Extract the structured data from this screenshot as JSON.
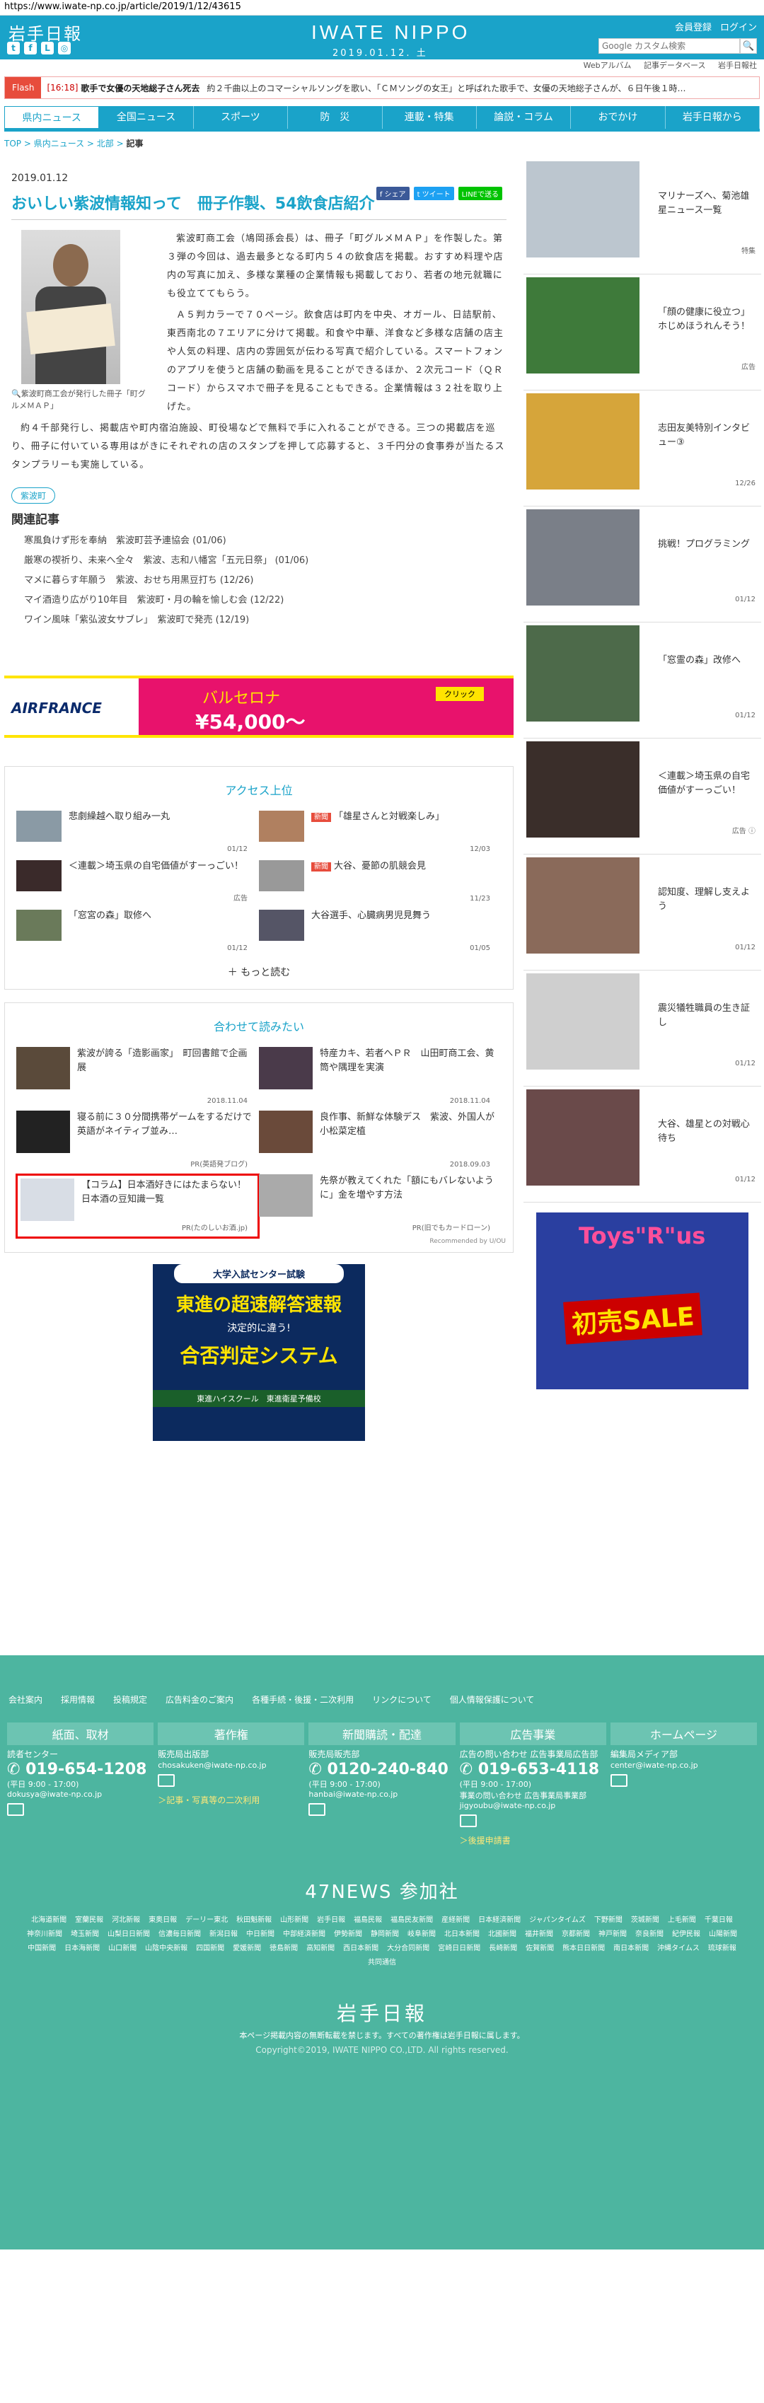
{
  "url": "https://www.iwate-np.co.jp/article/2019/1/12/43615",
  "header": {
    "logo_ja": "岩手日報",
    "logo_en": "IWATE NIPPO",
    "date": "2019.01.12. 土",
    "member": "会員登録",
    "login": "ログイン",
    "search_placeholder": "Google カスタム検索",
    "search_button": "🔍"
  },
  "subnav": [
    "Webアルバム",
    "記事データベース",
    "岩手日報社"
  ],
  "flash": {
    "tag": "Flash",
    "time": "[16:18]",
    "title": "歌手で女優の天地総子さん死去",
    "rest": "約２千曲以上のコマーシャルソングを歌い、「ＣＭソングの女王」と呼ばれた歌手で、女優の天地総子さんが、６日午後１時…"
  },
  "nav": [
    "県内ニュース",
    "全国ニュース",
    "スポーツ",
    "防　災",
    "連載・特集",
    "論説・コラム",
    "おでかけ",
    "岩手日報から"
  ],
  "breadcrumb": [
    "TOP",
    "県内ニュース",
    "北部",
    "記事"
  ],
  "article": {
    "date": "2019.01.12",
    "share": [
      "f シェア",
      "t ツイート",
      "LINEで送る"
    ],
    "title": "おいしい紫波情報知って　冊子作製、54飲食店紹介",
    "caption": "紫波町商工会が発行した冊子「町グルメＭＡＰ」",
    "p1": "紫波町商工会（鳩岡孫会長）は、冊子「町グルメＭＡＰ」を作製した。第３弾の今回は、過去最多となる町内５４の飲食店を掲載。おすすめ料理や店内の写真に加え、多様な業種の企業情報も掲載しており、若者の地元就職にも役立ててもらう。",
    "p2": "Ａ５判カラーで７０ページ。飲食店は町内を中央、オガール、日詰駅前、東西南北の７エリアに分けて掲載。和食や中華、洋食など多様な店舗の店主や人気の料理、店内の雰囲気が伝わる写真で紹介している。スマートフォンのアプリを使うと店舗の動画を見ることができるほか、２次元コード（ＱＲコード）からスマホで冊子を見ることもできる。企業情報は３２社を取り上げた。",
    "p3": "約４千部発行し、掲載店や町内宿泊施設、町役場などで無料で手に入れることができる。三つの掲載店を巡り、冊子に付いている専用はがきにそれぞれの店のスタンプを押して応募すると、３千円分の食事券が当たるスタンプラリーも実施している。",
    "tag": "紫波町",
    "related_heading": "関連記事",
    "related": [
      "寒風負けず形を奉納　紫波町芸予連協会 (01/06)",
      "厳寒の禊祈り、未来へ全々　紫波、志和八幡宮「五元日祭」 (01/06)",
      "マメに暮らす年願う　紫波、おせち用黒豆打ち (12/26)",
      "マイ酒造り広がり10年目　紫波町・月の輪を愉しむ会 (12/22)",
      "ワイン風味「紫弘波女サブレ」　紫波町で発売 (12/19)"
    ]
  },
  "banner": {
    "brand": "AIRFRANCE",
    "city": "バルセロナ",
    "price": "¥54,000～",
    "btn": "クリック"
  },
  "access": {
    "heading": "アクセス上位",
    "more": "＋ もっと読む",
    "items": [
      {
        "text": "悲劇繰越へ取り組み一丸",
        "date": "01/12",
        "new": ""
      },
      {
        "text": "「雄星さんと対戦楽しみ」",
        "date": "12/03",
        "new": "新聞"
      },
      {
        "text": "＜連載＞埼玉県の自宅価値がすーっごい！",
        "date": "広告",
        "new": ""
      },
      {
        "text": "大谷、憂節の肌競会見",
        "date": "11/23",
        "new": "新聞"
      },
      {
        "text": "「窓宮の森」取修へ",
        "date": "01/12",
        "new": ""
      },
      {
        "text": "大谷選手、心臓病男児見舞う",
        "date": "01/05",
        "new": ""
      }
    ]
  },
  "recommend": {
    "heading": "合わせて読みたい",
    "by": "Recommended by U/OU",
    "items": [
      {
        "text": "紫波が誇る「造影画家」　町回書館で企画展",
        "src": "2018.11.04"
      },
      {
        "text": "特産カキ、若者へＰＲ　山田町商工会、黄筒や隅理を実演",
        "src": "2018.11.04"
      },
      {
        "text": "寝る前に３０分間携帯ゲームをするだけで英語がネイティブ並み…",
        "src": "PR(英語発ブログ)"
      },
      {
        "text": "良作事、新鮮な体験デス　紫波、外国人が小松菜定植",
        "src": "2018.09.03"
      },
      {
        "text": "【コラム】日本酒好きにはたまらない！日本酒の豆知識一覧",
        "src": "PR(たのしいお酒.jp)"
      },
      {
        "text": "先祭が教えてくれた「額にもバレないように」金を増やす方法",
        "src": "PR(旧でもカードローン)"
      }
    ]
  },
  "ad2": {
    "t1": "大学入試センター試験",
    "t2": "東進の超速解答速報",
    "t3": "決定的に違う!",
    "t4": "合否判定システム",
    "t5": "東進ハイスクール　東進衛星予備校"
  },
  "side": [
    {
      "text": "マリナーズへ、菊池雄星ニュース一覧",
      "date": "特集"
    },
    {
      "text": "「顔の健康に役立つ」ホじめほうれんそう！",
      "date": "広告"
    },
    {
      "text": "志田友美特別インタビュー③",
      "date": "12/26"
    },
    {
      "text": "挑戦！プログラミング",
      "date": "01/12"
    },
    {
      "text": "「窓霊の森」改修へ",
      "date": "01/12"
    },
    {
      "text": "＜連載＞埼玉県の自宅価値がすーっごい！",
      "date": "広告 ⓘ"
    },
    {
      "text": "認知度、理解し支えよう",
      "date": "01/12"
    },
    {
      "text": "震災犠牲職員の生き証し",
      "date": "01/12"
    },
    {
      "text": "大谷、雄星との対戦心待ち",
      "date": "01/12"
    }
  ],
  "ad_toys": {
    "logo": "Toys\"R\"us",
    "sale": "初売SALE"
  },
  "footer": {
    "links": [
      "会社案内",
      "採用情報",
      "投稿規定",
      "広告料金のご案内",
      "各種手続・後援・二次利用",
      "リンクについて",
      "個人情報保護について"
    ],
    "cols": [
      {
        "hd": "紙面、取材",
        "l1": "読者センター",
        "tel": "019-654-1208",
        "hours": "(平日 9:00 - 17:00)",
        "mail": "dokusya@iwate-np.co.jp",
        "link": ""
      },
      {
        "hd": "著作権",
        "l1": "販売局出版部",
        "tel": "",
        "hours": "",
        "mail": "chosakuken@iwate-np.co.jp",
        "link": "＞記事・写真等の二次利用"
      },
      {
        "hd": "新聞購読・配達",
        "l1": "販売局販売部",
        "tel": "0120-240-840",
        "hours": "(平日 9:00 - 17:00)",
        "mail": "hanbai@iwate-np.co.jp",
        "link": ""
      },
      {
        "hd": "広告事業",
        "l1": "広告の問い合わせ 広告事業局広告部",
        "tel": "019-653-4118",
        "hours": "(平日 9:00 - 17:00)",
        "mail": "事業の問い合わせ 広告事業局事業部 jigyoubu@iwate-np.co.jp",
        "link": "＞後援申請書"
      },
      {
        "hd": "ホームページ",
        "l1": "編集局メディア部",
        "tel": "",
        "hours": "",
        "mail": "center@iwate-np.co.jp",
        "link": ""
      }
    ],
    "news47": "47NEWS 参加社",
    "papers": [
      "北海道新聞",
      "室蘭民報",
      "河北新報",
      "東奥日報",
      "デーリー東北",
      "秋田魁新報",
      "山形新聞",
      "岩手日報",
      "福島民報",
      "福島民友新聞",
      "産経新聞",
      "日本経済新聞",
      "ジャパンタイムズ",
      "下野新聞",
      "茨城新聞",
      "上毛新聞",
      "千葉日報",
      "神奈川新聞",
      "埼玉新聞",
      "山梨日日新聞",
      "信濃毎日新聞",
      "新潟日報",
      "中日新聞",
      "中部経済新聞",
      "伊勢新聞",
      "静岡新聞",
      "岐阜新聞",
      "北日本新聞",
      "北國新聞",
      "福井新聞",
      "京都新聞",
      "神戸新聞",
      "奈良新聞",
      "紀伊民報",
      "山陽新聞",
      "中国新聞",
      "日本海新聞",
      "山口新聞",
      "山陰中央新報",
      "四国新聞",
      "愛媛新聞",
      "徳島新聞",
      "高知新聞",
      "西日本新聞",
      "大分合同新聞",
      "宮崎日日新聞",
      "長崎新聞",
      "佐賀新聞",
      "熊本日日新聞",
      "南日本新聞",
      "沖縄タイムス",
      "琉球新報",
      "共同通信"
    ],
    "logo": "岩手日報",
    "note": "本ページ掲載内容の無断転載を禁じます。すべての著作権は岩手日報に属します。",
    "copy": "Copyright©2019, IWATE NIPPO CO.,LTD. All rights reserved."
  },
  "colors": {
    "accent": "#1aa3c9",
    "footer": "#4db5a0"
  }
}
